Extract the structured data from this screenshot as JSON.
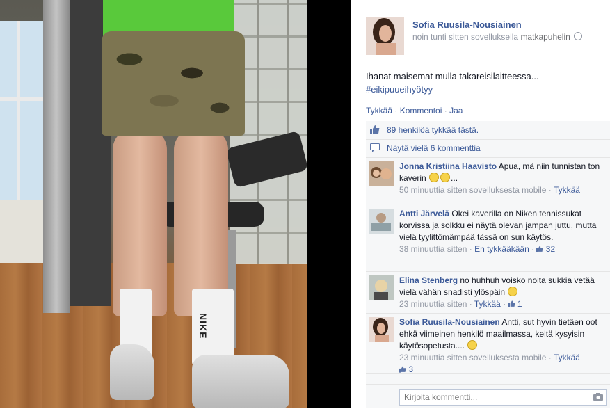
{
  "post": {
    "author": "Sofia Ruusila-Nousiainen",
    "time": "noin tunti sitten sovelluksella",
    "app": "matkapuhelin",
    "text": "Ihanat maisemat mulla takareisilaitteessa...",
    "hashtag": "#eikipuueihyötyy",
    "actions": {
      "like": "Tykkää",
      "comment": "Kommentoi",
      "share": "Jaa",
      "separator": "·"
    }
  },
  "likes": {
    "text": "89 henkilöä tykkää tästä."
  },
  "more_comments": {
    "text": "Näytä vielä 6 kommenttia"
  },
  "comments": [
    {
      "author": "Jonna Kristiina Haavisto",
      "text": "Apua, mä niin tunnistan ton kaverin",
      "time": "50 minuuttia sitten sovelluksesta mobile",
      "like_label": "Tykkää",
      "likes": ""
    },
    {
      "author": "Antti Järvelä",
      "text": "Okei kaverilla on Niken tennissukat korvissa ja solkku ei näytä olevan jampan juttu, mutta vielä tyylittömämpää tässä on sun käytös.",
      "time": "38 minuuttia sitten",
      "like_label": "En tykkääkään",
      "likes": "32"
    },
    {
      "author": "Elina Stenberg",
      "text": "no huhhuh voisko noita sukkia vetää vielä vähän snadisti ylöspäin",
      "time": "23 minuuttia sitten",
      "like_label": "Tykkää",
      "likes": "1"
    },
    {
      "author": "Sofia Ruusila-Nousiainen",
      "text": "Antti, sut hyvin tietäen oot ehkä viimeinen henkilö maailmassa, keltä kysyisin käytösopetusta....",
      "time": "23 minuuttia sitten sovelluksesta mobile",
      "like_label": "Tykkää",
      "likes": "3"
    }
  ],
  "composer": {
    "placeholder": "Kirjoita kommentti..."
  },
  "photo": {
    "sock_text": "NIKE"
  },
  "colors": {
    "link": "#3b5998",
    "meta": "#9197a3",
    "ufi_bg": "#f6f7f8"
  }
}
